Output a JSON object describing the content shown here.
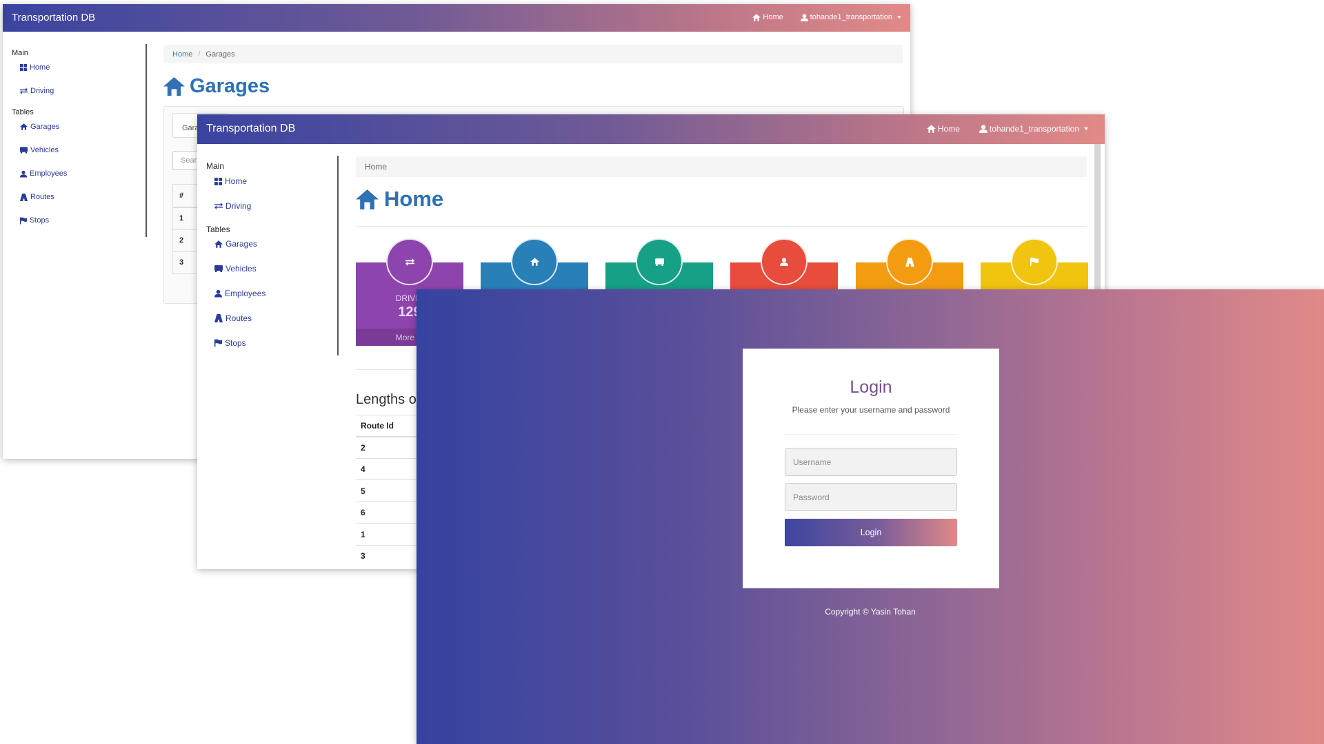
{
  "app": {
    "brand": "Transportation DB",
    "nav_home": "Home",
    "user_menu": "tohande1_transportation"
  },
  "sidebar": {
    "main_heading": "Main",
    "tables_heading": "Tables",
    "items": {
      "home": "Home",
      "driving": "Driving",
      "garages": "Garages",
      "vehicles": "Vehicles",
      "employees": "Employees",
      "routes": "Routes",
      "stops": "Stops"
    }
  },
  "garages_page": {
    "breadcrumb_home": "Home",
    "breadcrumb_current": "Garages",
    "title": "Garages",
    "tab_partial": "Gara",
    "search_partial": "Sear",
    "table_header_partial": "#",
    "rows": [
      "1",
      "2",
      "3"
    ]
  },
  "home_page": {
    "breadcrumb": "Home",
    "title": "Home",
    "cards": [
      {
        "name": "driving",
        "icon": "exchange-icon",
        "color": "#8e44ad",
        "label_partial": "DRIVIN",
        "count_partial": "129",
        "link_partial": "More In"
      },
      {
        "name": "garages",
        "icon": "home-icon",
        "color": "#2980b9"
      },
      {
        "name": "vehicles",
        "icon": "bus-icon",
        "color": "#16a085"
      },
      {
        "name": "employees",
        "icon": "user-icon",
        "color": "#e74c3c"
      },
      {
        "name": "routes",
        "icon": "road-icon",
        "color": "#f39c12"
      },
      {
        "name": "stops",
        "icon": "flag-icon",
        "color": "#f1c40f"
      }
    ],
    "lengths_title_partial": "Lengths o",
    "route_table": {
      "header": "Route Id",
      "rows": [
        "2",
        "4",
        "5",
        "6",
        "1",
        "3"
      ]
    }
  },
  "login": {
    "title": "Login",
    "subtitle": "Please enter your username and password",
    "username_placeholder": "Username",
    "password_placeholder": "Password",
    "button": "Login",
    "copyright": "Copyright © Yasin Tohan"
  }
}
